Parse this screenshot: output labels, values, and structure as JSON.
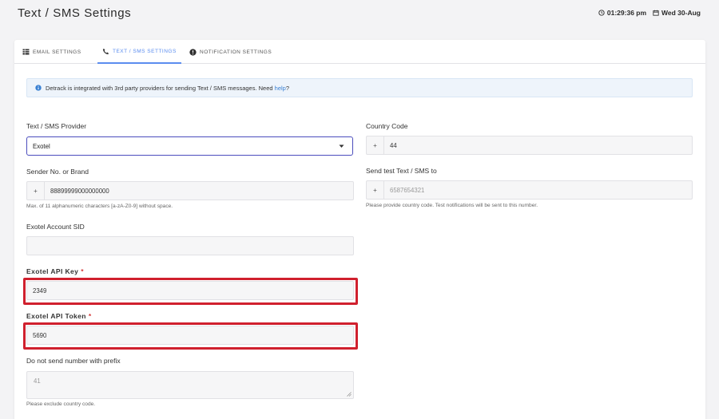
{
  "header": {
    "title": "Text / SMS Settings",
    "time": "01:29:36 pm",
    "date": "Wed 30-Aug"
  },
  "tabs": [
    {
      "label": "EMAIL SETTINGS",
      "icon": "table-icon"
    },
    {
      "label": "TEXT / SMS SETTINGS",
      "icon": "phone-icon",
      "active": true
    },
    {
      "label": "NOTIFICATION SETTINGS",
      "icon": "exclamation-circle-icon"
    }
  ],
  "info": {
    "text": "Detrack is integrated with 3rd party providers for sending Text / SMS messages. Need",
    "link": "help",
    "suffix": "?"
  },
  "form": {
    "provider_label": "Text / SMS Provider",
    "provider_value": "Exotel",
    "country_code_label": "Country Code",
    "country_code_prefix": "+",
    "country_code_value": "44",
    "sender_label": "Sender No. or Brand",
    "sender_prefix": "+",
    "sender_value": "88899999000000000",
    "sender_help": "Max. of 11 alphanumeric characters [a-zA-Z0-9] without space.",
    "test_label": "Send test Text / SMS to",
    "test_prefix": "+",
    "test_placeholder": "6587654321",
    "test_help": "Please provide country code. Test notifications will be sent to this number.",
    "sid_label": "Exotel Account SID",
    "sid_value": "",
    "api_key_label": "Exotel API Key",
    "api_key_value": "2349",
    "api_token_label": "Exotel API Token",
    "api_token_value": "5690",
    "prefix_label": "Do not send number with prefix",
    "prefix_placeholder": "41",
    "prefix_help": "Please exclude country code.",
    "required_mark": "*"
  },
  "colors": {
    "accent": "#5b8def",
    "highlight": "#d0202e",
    "select_border": "#4b4dbd"
  }
}
